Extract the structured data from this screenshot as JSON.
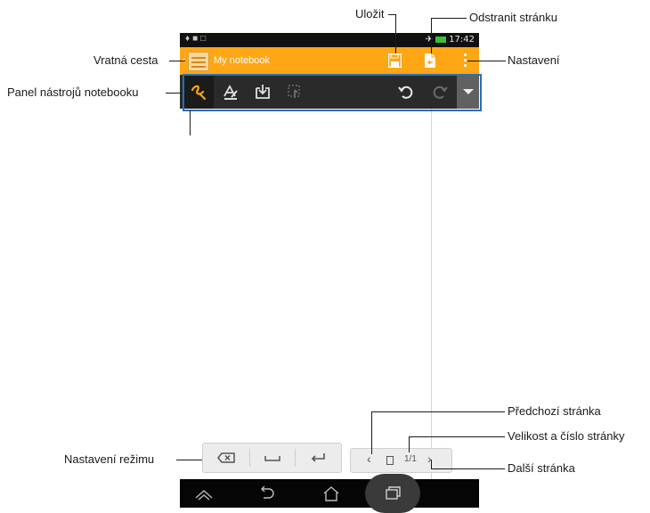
{
  "status_bar": {
    "time": "17:42"
  },
  "app_bar": {
    "title": "My notebook"
  },
  "page_nav": {
    "page_indicator": "1/1"
  },
  "callouts": {
    "save": "Uložit",
    "delete_page": "Odstranit stránku",
    "back": "Vratná cesta",
    "settings": "Nastavení",
    "toolbar": "Panel nástrojů notebooku",
    "prev_page": "Předchozí stránka",
    "page_size_number": "Velikost a číslo stránky",
    "next_page": "Další stránka",
    "mode_settings": "Nastavení režimu"
  },
  "colors": {
    "app_bar": "#ffa615",
    "toolbar": "#2a2a2a",
    "callout_box": "#2a6eb8",
    "pen_active": "#ffa615"
  },
  "icons": {
    "toolbar": [
      "pen-icon",
      "eraser-style-icon",
      "import-icon",
      "select-icon",
      "undo-icon",
      "redo-icon",
      "dropdown-icon"
    ],
    "mode": [
      "backspace-icon",
      "space-icon",
      "enter-icon"
    ],
    "nav": [
      "back-nav-icon",
      "home-icon",
      "recent-apps-icon"
    ]
  }
}
